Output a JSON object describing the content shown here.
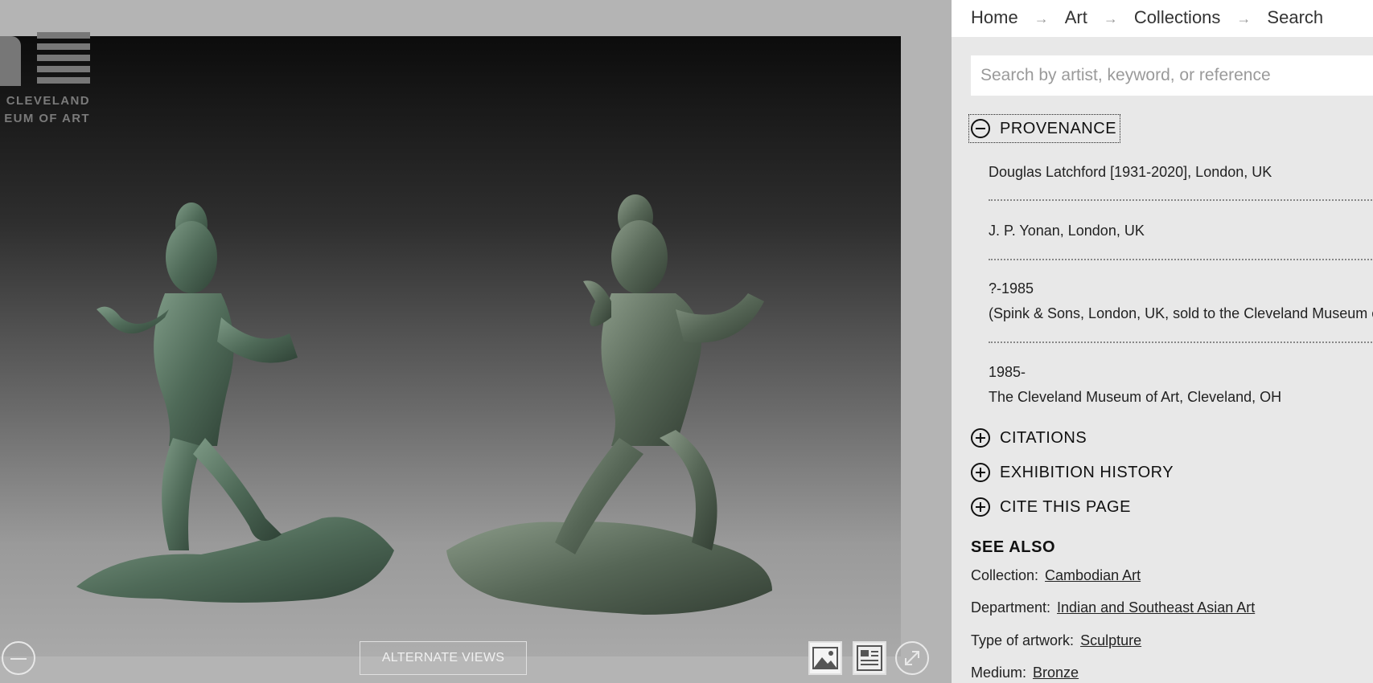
{
  "logo": {
    "line1": "CLEVELAND",
    "line2": "EUM OF ART"
  },
  "image_viewer": {
    "alternate_views_label": "ALTERNATE VIEWS",
    "artwork_icon": "bronze-figures-image"
  },
  "breadcrumb": [
    "Home",
    "Art",
    "Collections",
    "Search"
  ],
  "breadcrumb_separator": "→",
  "search": {
    "placeholder": "Search by artist, keyword, or reference",
    "value": ""
  },
  "sections": {
    "provenance": "PROVENANCE",
    "citations": "CITATIONS",
    "exhibition_history": "EXHIBITION HISTORY",
    "cite_this_page": "CITE THIS PAGE"
  },
  "provenance": [
    {
      "line1": "Douglas Latchford [1931-2020], London, UK",
      "line2": ""
    },
    {
      "line1": "J. P. Yonan, London, UK",
      "line2": ""
    },
    {
      "line1": "?-1985",
      "line2": "(Spink & Sons, London, UK, sold to the Cleveland Museum of Art)"
    },
    {
      "line1": "1985-",
      "line2": "The Cleveland Museum of Art, Cleveland, OH"
    }
  ],
  "see_also": {
    "title": "SEE ALSO",
    "rows": [
      {
        "label": "Collection:",
        "value": "Cambodian Art"
      },
      {
        "label": "Department:",
        "value": "Indian and Southeast Asian Art"
      },
      {
        "label": "Type of artwork:",
        "value": "Sculpture"
      },
      {
        "label": "Medium:",
        "value": "Bronze"
      }
    ]
  },
  "colors": {
    "panel_bg": "#e8e8e8",
    "image_bg": "#b4b4b4",
    "bronze": "#4f6a58"
  }
}
